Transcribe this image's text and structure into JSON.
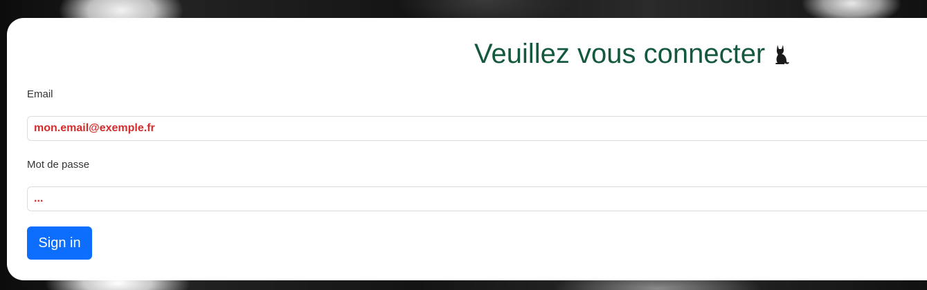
{
  "page": {
    "title": "Veuillez vous connecter",
    "title_icon": "cat-icon"
  },
  "form": {
    "email_label": "Email",
    "email_value": "mon.email@exemple.fr",
    "password_label": "Mot de passe",
    "password_value": "...",
    "submit_label": "Sign in"
  },
  "colors": {
    "title": "#14593e",
    "input_text": "#d42c2c",
    "button": "#0d6efd",
    "card": "#ffffff"
  }
}
